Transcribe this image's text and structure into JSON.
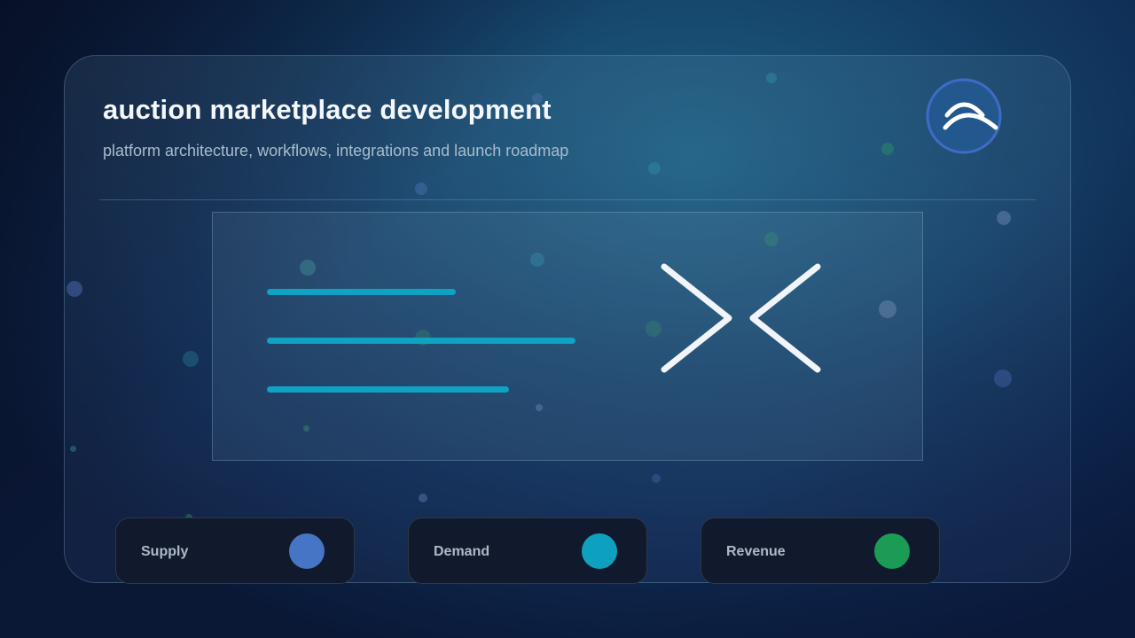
{
  "header": {
    "title": "auction marketplace development",
    "subtitle": "platform architecture, workflows, integrations and launch roadmap"
  },
  "logo": {
    "icon": "double-arch-icon"
  },
  "illustration": {
    "icon": "double-chevron-icon",
    "line_color": "#0fa2c2"
  },
  "stats": [
    {
      "label": "Supply",
      "color": "#4575c4"
    },
    {
      "label": "Demand",
      "color": "#0ea1bf"
    },
    {
      "label": "Revenue",
      "color": "#1a9c55"
    }
  ]
}
